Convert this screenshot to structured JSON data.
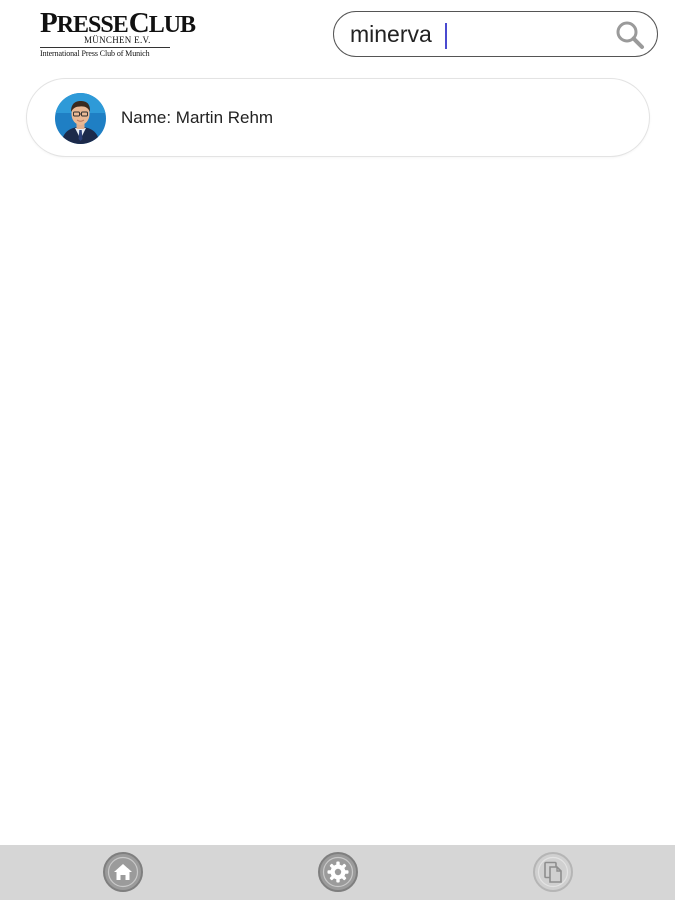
{
  "header": {
    "logo": {
      "line1_p": "P",
      "line1_resse": "RESSE",
      "line1_c": "C",
      "line1_lub": "LUB",
      "line2": "MÜNCHEN E.V.",
      "tagline": "International Press Club of Munich"
    },
    "search": {
      "value": "minerva",
      "icon": "search-icon"
    }
  },
  "results": [
    {
      "label": "Name: Martin Rehm",
      "avatar": "person-photo"
    }
  ],
  "bottom_nav": {
    "items": [
      {
        "icon": "home-icon"
      },
      {
        "icon": "gear-icon"
      },
      {
        "icon": "copy-icon"
      }
    ]
  },
  "colors": {
    "nav_background": "#d6d6d6",
    "avatar_background": "#1f7fc4",
    "card_border": "#e3e3e3"
  }
}
